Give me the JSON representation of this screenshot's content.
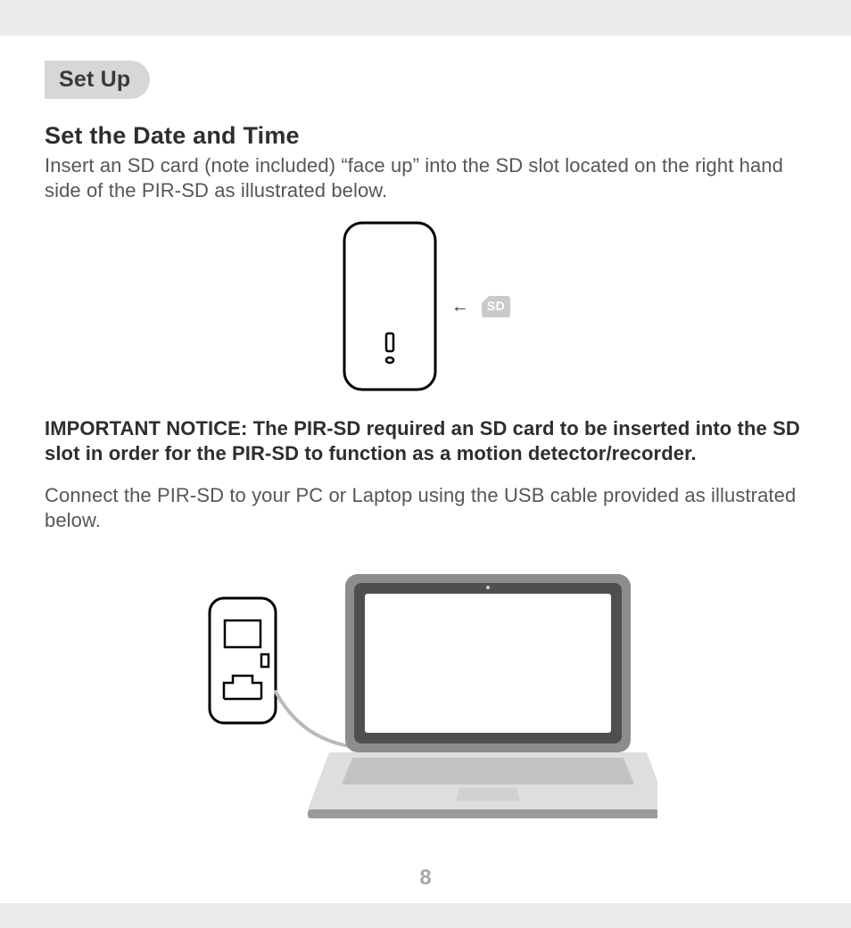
{
  "section_tab": "Set Up",
  "heading": "Set the Date and Time",
  "intro": "Insert an SD card (note included) “face up” into the SD slot located on the right hand side of the PIR-SD as illustrated below.",
  "sd_card_label": "SD",
  "arrow_glyph": "←",
  "notice": "IMPORTANT NOTICE: The PIR-SD required an SD card to be inserted into the SD slot in order for the PIR-SD to function as a motion detector/recorder.",
  "connect_text": "Connect the PIR-SD to your PC or Laptop using the USB cable provided as illustrated below.",
  "page_number": "8",
  "colors": {
    "band": "#eaebec",
    "tab": "#d6d7d8",
    "text": "#555657",
    "bold": "#2e2e2e",
    "page_num": "#a7a8a9",
    "sd_bg": "#c9cacb"
  }
}
